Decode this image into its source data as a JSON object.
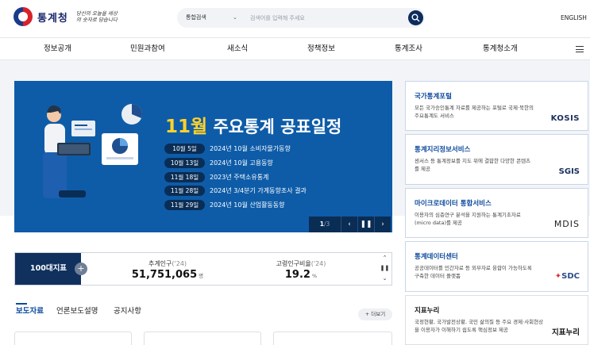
{
  "header": {
    "logo_text": "통계청",
    "slogan": "당신의 오늘을 세상의 숫자로 담습니다",
    "search_scope": "통합검색",
    "search_placeholder": "검색어를 입력해 주세요",
    "language": "ENGLISH"
  },
  "nav": {
    "items": [
      "정보공개",
      "민원과참여",
      "새소식",
      "정책정보",
      "통계조사",
      "통계청소개"
    ]
  },
  "banner": {
    "title_highlight": "11월",
    "title_rest": "주요통계 공표일정",
    "schedule": [
      {
        "date": "10월  5일",
        "text": "2024년 10월 소비자물가동향"
      },
      {
        "date": "10월 13일",
        "text": "2024년 10월 고용동향"
      },
      {
        "date": "11월 18일",
        "text": "2023년 주택소유통계"
      },
      {
        "date": "11월 28일",
        "text": "2024년 3/4분기 가계동향조사 결과"
      },
      {
        "date": "11월 29일",
        "text": "2024년 10월 산업활동동향"
      }
    ],
    "pager_current": "1",
    "pager_total": "/3"
  },
  "indicator": {
    "label": "100대지표",
    "stats": [
      {
        "label": "추계인구",
        "period": "('24)",
        "value": "51,751,065",
        "unit": "명"
      },
      {
        "label": "고령인구비율",
        "period": "('24)",
        "value": "19.2",
        "unit": "%"
      }
    ]
  },
  "tabs": {
    "items": [
      "보도자료",
      "언론보도설명",
      "공지사항"
    ],
    "more": "+ 더보기"
  },
  "services": [
    {
      "title": "국가통계포털",
      "desc": "모든 국가승인통계 자료를 제공하는 포털로 국제·북한의 주요통계도 서비스",
      "logo": "KOSIS"
    },
    {
      "title": "통계지리정보서비스",
      "desc": "센서스 등 통계정보를 지도 위에 결합한 다양한 콘텐츠를 제공",
      "logo": "SGIS"
    },
    {
      "title": "마이크로데이터 통합서비스",
      "desc": "이용자의 심층연구 분석을 지원하는 통계기초자료(micro data)를 제공",
      "logo": "MDIS"
    },
    {
      "title": "통계데이터센터",
      "desc": "공공데이터를 민간자료 등 외부자료 융합이 가능하도록 구축한 데이터 플랫폼",
      "logo": "SDC"
    },
    {
      "title": "지표누리",
      "desc": "국정현황, 국가발전상황, 국민 삶의질 등 주요 경제·사회현상을 이용자가 이해하기 쉽도록 핵심정보 제공",
      "logo": "지표누리"
    }
  ],
  "colors": {
    "banner_bg": "#0e5ca8",
    "navy": "#10305e",
    "accent_yellow": "#ffd12a",
    "link_blue": "#0d4a9c"
  }
}
